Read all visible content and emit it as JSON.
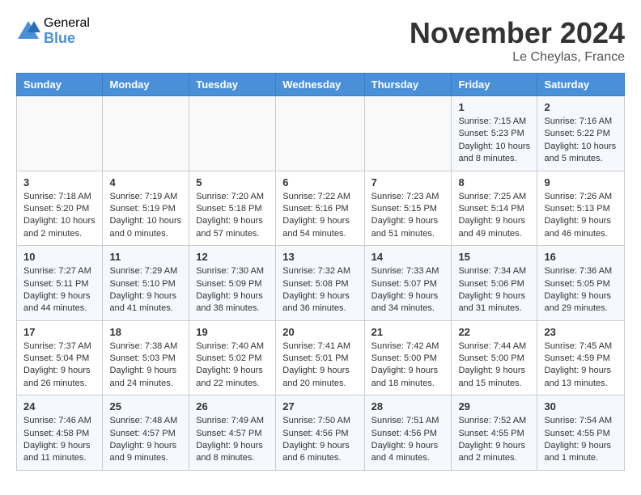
{
  "header": {
    "logo_general": "General",
    "logo_blue": "Blue",
    "title": "November 2024",
    "location": "Le Cheylas, France"
  },
  "days_of_week": [
    "Sunday",
    "Monday",
    "Tuesday",
    "Wednesday",
    "Thursday",
    "Friday",
    "Saturday"
  ],
  "weeks": [
    [
      {
        "day": "",
        "info": ""
      },
      {
        "day": "",
        "info": ""
      },
      {
        "day": "",
        "info": ""
      },
      {
        "day": "",
        "info": ""
      },
      {
        "day": "",
        "info": ""
      },
      {
        "day": "1",
        "info": "Sunrise: 7:15 AM\nSunset: 5:23 PM\nDaylight: 10 hours and 8 minutes."
      },
      {
        "day": "2",
        "info": "Sunrise: 7:16 AM\nSunset: 5:22 PM\nDaylight: 10 hours and 5 minutes."
      }
    ],
    [
      {
        "day": "3",
        "info": "Sunrise: 7:18 AM\nSunset: 5:20 PM\nDaylight: 10 hours and 2 minutes."
      },
      {
        "day": "4",
        "info": "Sunrise: 7:19 AM\nSunset: 5:19 PM\nDaylight: 10 hours and 0 minutes."
      },
      {
        "day": "5",
        "info": "Sunrise: 7:20 AM\nSunset: 5:18 PM\nDaylight: 9 hours and 57 minutes."
      },
      {
        "day": "6",
        "info": "Sunrise: 7:22 AM\nSunset: 5:16 PM\nDaylight: 9 hours and 54 minutes."
      },
      {
        "day": "7",
        "info": "Sunrise: 7:23 AM\nSunset: 5:15 PM\nDaylight: 9 hours and 51 minutes."
      },
      {
        "day": "8",
        "info": "Sunrise: 7:25 AM\nSunset: 5:14 PM\nDaylight: 9 hours and 49 minutes."
      },
      {
        "day": "9",
        "info": "Sunrise: 7:26 AM\nSunset: 5:13 PM\nDaylight: 9 hours and 46 minutes."
      }
    ],
    [
      {
        "day": "10",
        "info": "Sunrise: 7:27 AM\nSunset: 5:11 PM\nDaylight: 9 hours and 44 minutes."
      },
      {
        "day": "11",
        "info": "Sunrise: 7:29 AM\nSunset: 5:10 PM\nDaylight: 9 hours and 41 minutes."
      },
      {
        "day": "12",
        "info": "Sunrise: 7:30 AM\nSunset: 5:09 PM\nDaylight: 9 hours and 38 minutes."
      },
      {
        "day": "13",
        "info": "Sunrise: 7:32 AM\nSunset: 5:08 PM\nDaylight: 9 hours and 36 minutes."
      },
      {
        "day": "14",
        "info": "Sunrise: 7:33 AM\nSunset: 5:07 PM\nDaylight: 9 hours and 34 minutes."
      },
      {
        "day": "15",
        "info": "Sunrise: 7:34 AM\nSunset: 5:06 PM\nDaylight: 9 hours and 31 minutes."
      },
      {
        "day": "16",
        "info": "Sunrise: 7:36 AM\nSunset: 5:05 PM\nDaylight: 9 hours and 29 minutes."
      }
    ],
    [
      {
        "day": "17",
        "info": "Sunrise: 7:37 AM\nSunset: 5:04 PM\nDaylight: 9 hours and 26 minutes."
      },
      {
        "day": "18",
        "info": "Sunrise: 7:38 AM\nSunset: 5:03 PM\nDaylight: 9 hours and 24 minutes."
      },
      {
        "day": "19",
        "info": "Sunrise: 7:40 AM\nSunset: 5:02 PM\nDaylight: 9 hours and 22 minutes."
      },
      {
        "day": "20",
        "info": "Sunrise: 7:41 AM\nSunset: 5:01 PM\nDaylight: 9 hours and 20 minutes."
      },
      {
        "day": "21",
        "info": "Sunrise: 7:42 AM\nSunset: 5:00 PM\nDaylight: 9 hours and 18 minutes."
      },
      {
        "day": "22",
        "info": "Sunrise: 7:44 AM\nSunset: 5:00 PM\nDaylight: 9 hours and 15 minutes."
      },
      {
        "day": "23",
        "info": "Sunrise: 7:45 AM\nSunset: 4:59 PM\nDaylight: 9 hours and 13 minutes."
      }
    ],
    [
      {
        "day": "24",
        "info": "Sunrise: 7:46 AM\nSunset: 4:58 PM\nDaylight: 9 hours and 11 minutes."
      },
      {
        "day": "25",
        "info": "Sunrise: 7:48 AM\nSunset: 4:57 PM\nDaylight: 9 hours and 9 minutes."
      },
      {
        "day": "26",
        "info": "Sunrise: 7:49 AM\nSunset: 4:57 PM\nDaylight: 9 hours and 8 minutes."
      },
      {
        "day": "27",
        "info": "Sunrise: 7:50 AM\nSunset: 4:56 PM\nDaylight: 9 hours and 6 minutes."
      },
      {
        "day": "28",
        "info": "Sunrise: 7:51 AM\nSunset: 4:56 PM\nDaylight: 9 hours and 4 minutes."
      },
      {
        "day": "29",
        "info": "Sunrise: 7:52 AM\nSunset: 4:55 PM\nDaylight: 9 hours and 2 minutes."
      },
      {
        "day": "30",
        "info": "Sunrise: 7:54 AM\nSunset: 4:55 PM\nDaylight: 9 hours and 1 minute."
      }
    ]
  ]
}
